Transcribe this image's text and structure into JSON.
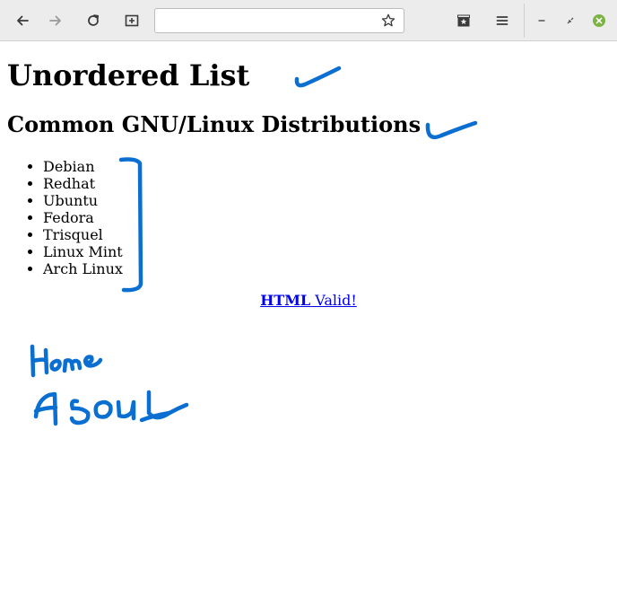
{
  "browser": {
    "url": "",
    "icons": {
      "back": "arrow-left-icon",
      "forward": "arrow-right-icon",
      "reload": "reload-icon",
      "new_tab": "new-tab-icon",
      "bookmark": "star-icon",
      "library": "bookmarks-library-icon",
      "menu": "hamburger-menu-icon",
      "minimize": "minimize-icon",
      "restore": "restore-icon",
      "close": "close-icon"
    },
    "close_color": "#7cb342"
  },
  "page": {
    "title": "Unordered List",
    "subtitle": "Common GNU/Linux Distributions",
    "distributions": [
      "Debian",
      "Redhat",
      "Ubuntu",
      "Fedora",
      "Trisquel",
      "Linux Mint",
      "Arch Linux"
    ],
    "validator_link": {
      "strong": "HTML",
      "text": " Valid!"
    }
  },
  "annotations": {
    "color": "#0a6fd1",
    "handwritten_notes": [
      "Home",
      "About"
    ]
  }
}
